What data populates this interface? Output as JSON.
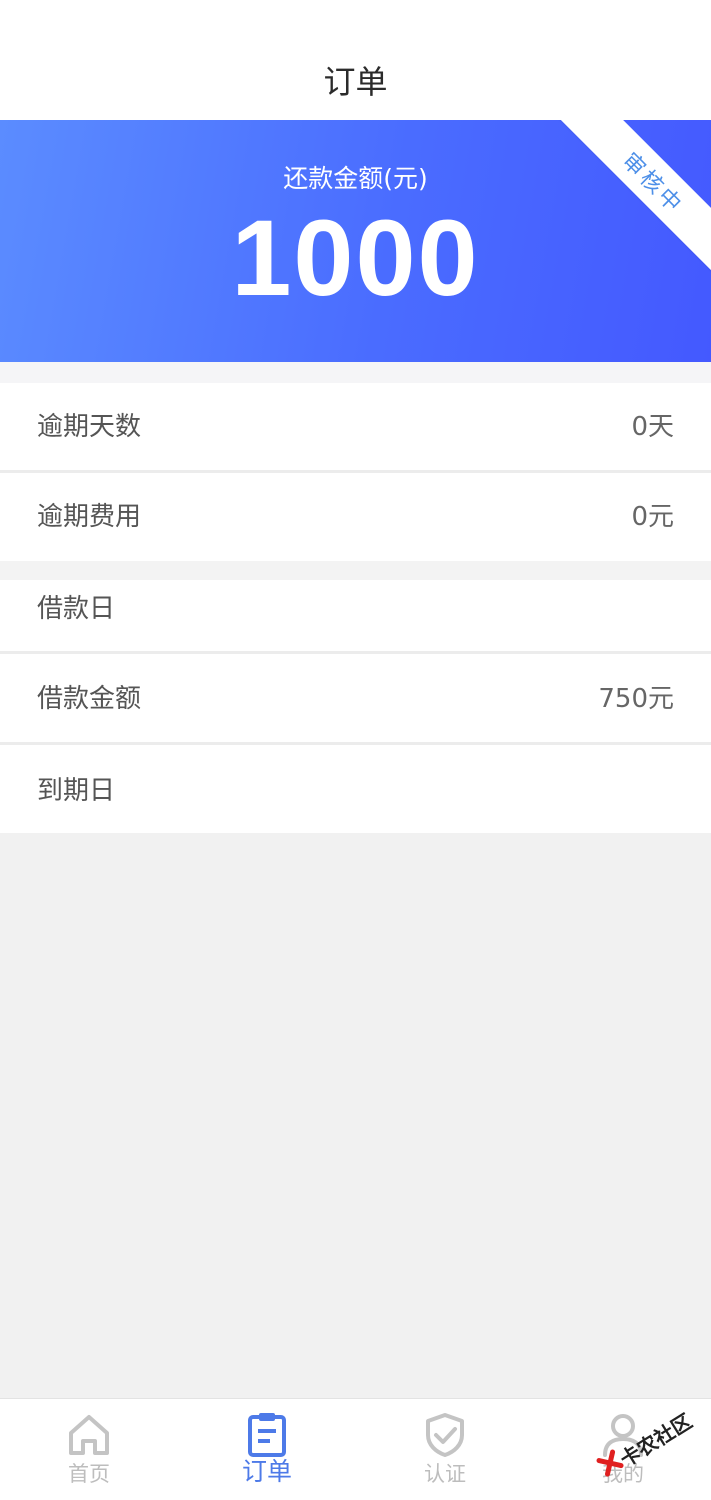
{
  "header": {
    "title": "订单"
  },
  "hero": {
    "label": "还款金额(元)",
    "amount": "1000",
    "status_ribbon": "审核中",
    "gradient_colors": [
      "#5b8cff",
      "#4459ff"
    ]
  },
  "details": {
    "overdue_days": {
      "label": "逾期天数",
      "value": "0天"
    },
    "overdue_fee": {
      "label": "逾期费用",
      "value": "0元"
    },
    "loan_date": {
      "label": "借款日",
      "value": ""
    },
    "loan_amount": {
      "label": "借款金额",
      "value": "750元"
    },
    "due_date": {
      "label": "到期日",
      "value": ""
    }
  },
  "tabbar": {
    "tabs": [
      {
        "label": "首页",
        "icon": "home-icon",
        "active": false
      },
      {
        "label": "订单",
        "icon": "clipboard-icon",
        "active": true
      },
      {
        "label": "认证",
        "icon": "shield-check-icon",
        "active": false
      },
      {
        "label": "我的",
        "icon": "user-icon",
        "active": false
      }
    ],
    "active_color": "#4d7ae8",
    "inactive_color": "#bdbdbd"
  },
  "watermark": {
    "text": "卡农社区"
  }
}
